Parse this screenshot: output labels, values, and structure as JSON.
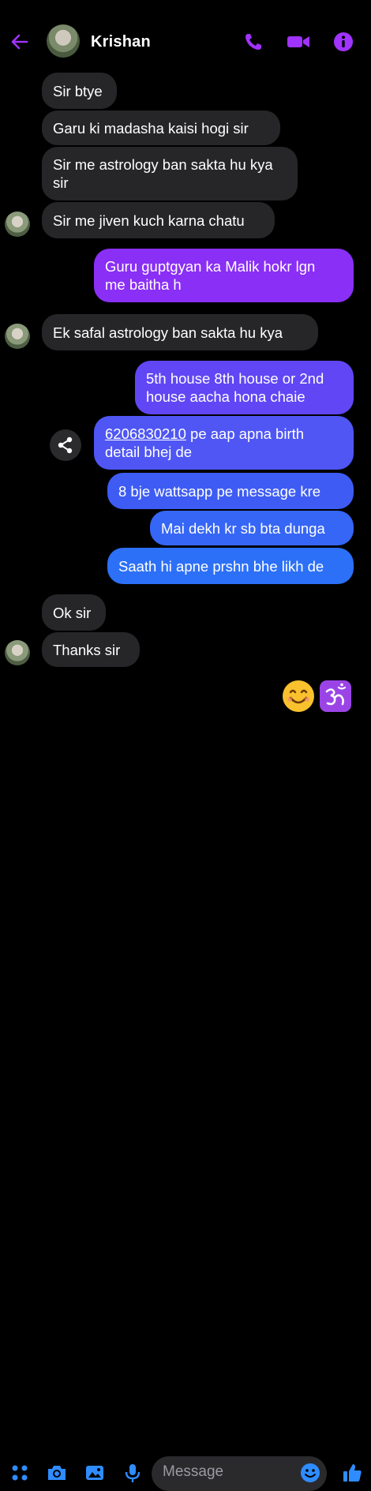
{
  "header": {
    "contact_name": "Krishan",
    "icons": [
      "back-arrow-icon",
      "phone-icon",
      "video-camera-icon",
      "info-icon"
    ],
    "accent_color": "#a033ff"
  },
  "messages": [
    {
      "dir": "in",
      "text": "Sir btye"
    },
    {
      "dir": "in",
      "text": "Garu ki madasha kaisi hogi sir"
    },
    {
      "dir": "in",
      "line1": "Sir me astrology ban sakta hu kya",
      "line2": "sir"
    },
    {
      "dir": "in",
      "text": "Sir me jiven kuch karna chatu"
    },
    {
      "dir": "out",
      "line1": "Guru guptgyan ka Malik hokr lgn",
      "line2": "me baitha h"
    },
    {
      "dir": "in",
      "text": "Ek safal astrology ban sakta hu kya"
    },
    {
      "dir": "out",
      "line1": "5th house 8th house or 2nd",
      "line2": "house aacha hona chaie"
    },
    {
      "dir": "out",
      "link": "6206830210",
      "line1_rest": " pe aap apna birth",
      "line2": "detail bhej de"
    },
    {
      "dir": "out",
      "text": "8 bje wattsapp pe message kre"
    },
    {
      "dir": "out",
      "text": "Mai dekh kr sb bta dunga"
    },
    {
      "dir": "out",
      "text": "Saath hi apne prshn bhe likh de"
    },
    {
      "dir": "in",
      "text": "Ok sir"
    },
    {
      "dir": "in",
      "text": "Thanks sir"
    }
  ],
  "reactions": {
    "emoji_1": "smiling-face-emoji",
    "emoji_2": "om-symbol-emoji"
  },
  "composer": {
    "placeholder": "Message",
    "icons": [
      "menu-dots-icon",
      "camera-icon",
      "gallery-icon",
      "microphone-icon",
      "emoji-icon",
      "thumbs-up-icon"
    ],
    "icon_color": "#2f8cff"
  }
}
